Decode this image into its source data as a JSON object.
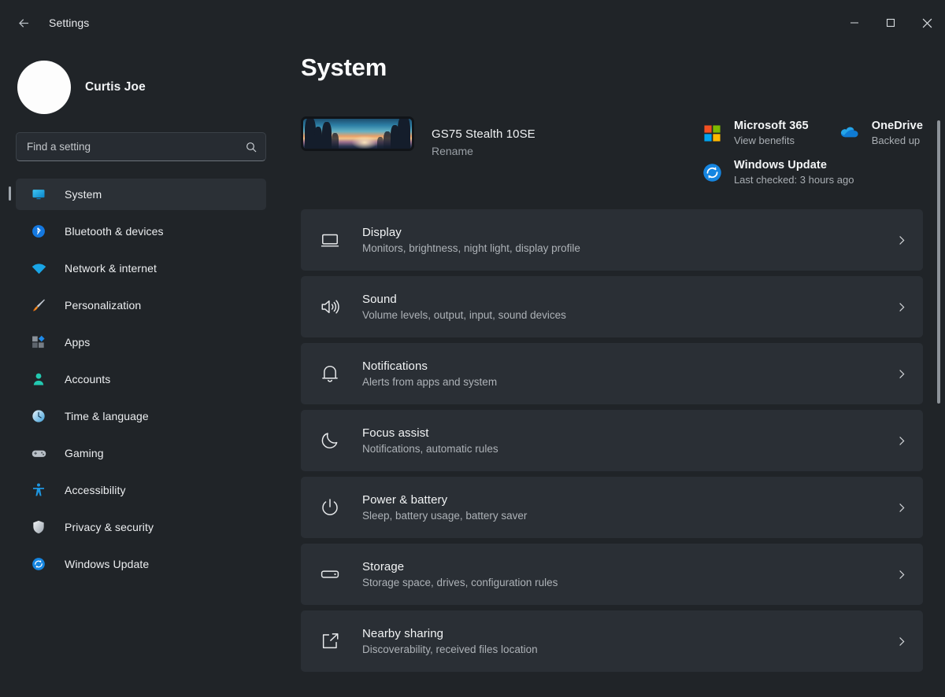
{
  "titlebar": {
    "back_icon": "back-arrow-icon",
    "title": "Settings",
    "minimize_label": "—",
    "maximize_label": "□",
    "close_label": "✕"
  },
  "sidebar": {
    "profile": {
      "name": "Curtis Joe",
      "avatar": "user-avatar"
    },
    "search": {
      "placeholder": "Find a setting",
      "value": "",
      "icon": "search-icon"
    },
    "items": [
      {
        "label": "System",
        "icon": "system-monitor-icon",
        "active": true
      },
      {
        "label": "Bluetooth & devices",
        "icon": "bluetooth-icon",
        "active": false
      },
      {
        "label": "Network & internet",
        "icon": "wifi-icon",
        "active": false
      },
      {
        "label": "Personalization",
        "icon": "paintbrush-icon",
        "active": false
      },
      {
        "label": "Apps",
        "icon": "apps-icon",
        "active": false
      },
      {
        "label": "Accounts",
        "icon": "account-person-icon",
        "active": false
      },
      {
        "label": "Time & language",
        "icon": "clock-icon",
        "active": false
      },
      {
        "label": "Gaming",
        "icon": "gamepad-icon",
        "active": false
      },
      {
        "label": "Accessibility",
        "icon": "accessibility-person-icon",
        "active": false
      },
      {
        "label": "Privacy & security",
        "icon": "shield-icon",
        "active": false
      },
      {
        "label": "Windows Update",
        "icon": "windows-update-sync-icon",
        "active": false
      }
    ]
  },
  "main": {
    "page_title": "System",
    "device": {
      "name": "GS75 Stealth 10SE",
      "rename_label": "Rename",
      "thumbnail": "device-wallpaper-thumbnail"
    },
    "status_cards": [
      {
        "title": "Microsoft 365",
        "subtitle": "View benefits",
        "icon": "microsoft-logo-icon"
      },
      {
        "title": "OneDrive",
        "subtitle": "Backed up",
        "icon": "onedrive-cloud-icon"
      },
      {
        "title": "Windows Update",
        "subtitle": "Last checked: 3 hours ago",
        "icon": "windows-update-sync-icon"
      }
    ],
    "settings_rows": [
      {
        "title": "Display",
        "subtitle": "Monitors, brightness, night light, display profile",
        "icon": "display-monitor-icon"
      },
      {
        "title": "Sound",
        "subtitle": "Volume levels, output, input, sound devices",
        "icon": "speaker-icon"
      },
      {
        "title": "Notifications",
        "subtitle": "Alerts from apps and system",
        "icon": "bell-icon"
      },
      {
        "title": "Focus assist",
        "subtitle": "Notifications, automatic rules",
        "icon": "moon-icon"
      },
      {
        "title": "Power & battery",
        "subtitle": "Sleep, battery usage, battery saver",
        "icon": "power-icon"
      },
      {
        "title": "Storage",
        "subtitle": "Storage space, drives, configuration rules",
        "icon": "drive-icon"
      },
      {
        "title": "Nearby sharing",
        "subtitle": "Discoverability, received files location",
        "icon": "share-icon"
      }
    ],
    "chevron_icon": "chevron-right-icon"
  },
  "colors": {
    "background": "#202428",
    "row_background": "#2a2f35",
    "accent_blue": "#0e7fd4",
    "text_primary": "#f2f4f5",
    "text_secondary": "#adb2b7"
  }
}
